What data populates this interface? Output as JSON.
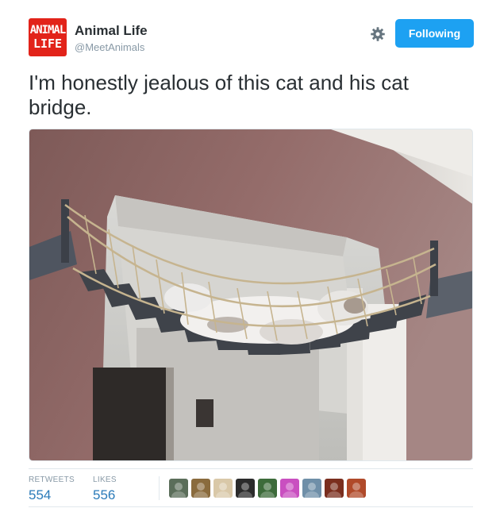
{
  "account": {
    "avatar_line1": "ANIMAL",
    "avatar_line2": "LIFE",
    "display_name": "Animal Life",
    "handle": "@MeetAnimals"
  },
  "header": {
    "settings_icon": "gear-icon",
    "follow_button_label": "Following"
  },
  "tweet": {
    "text": "I'm honestly jealous of this cat and his cat bridge."
  },
  "stats": {
    "retweets_label": "RETWEETS",
    "retweets_count": "554",
    "likes_label": "LIKES",
    "likes_count": "556"
  },
  "liker_avatars": [
    {
      "icon": "user-avatar-1",
      "color": "#5b6e5a"
    },
    {
      "icon": "user-avatar-2",
      "color": "#8a6b3d"
    },
    {
      "icon": "user-avatar-3",
      "color": "#d9c8a8"
    },
    {
      "icon": "user-avatar-4",
      "color": "#2b2b2b"
    },
    {
      "icon": "user-avatar-5",
      "color": "#3d6b3a"
    },
    {
      "icon": "user-avatar-6",
      "color": "#c94fc0"
    },
    {
      "icon": "user-avatar-7",
      "color": "#6f8fa8"
    },
    {
      "icon": "user-avatar-8",
      "color": "#7a2e1e"
    },
    {
      "icon": "user-avatar-9",
      "color": "#b04a2a"
    }
  ],
  "colors": {
    "accent": "#1da1f2",
    "link": "#2b7bb9",
    "muted": "#8899a6",
    "brand_red": "#e2231a"
  }
}
